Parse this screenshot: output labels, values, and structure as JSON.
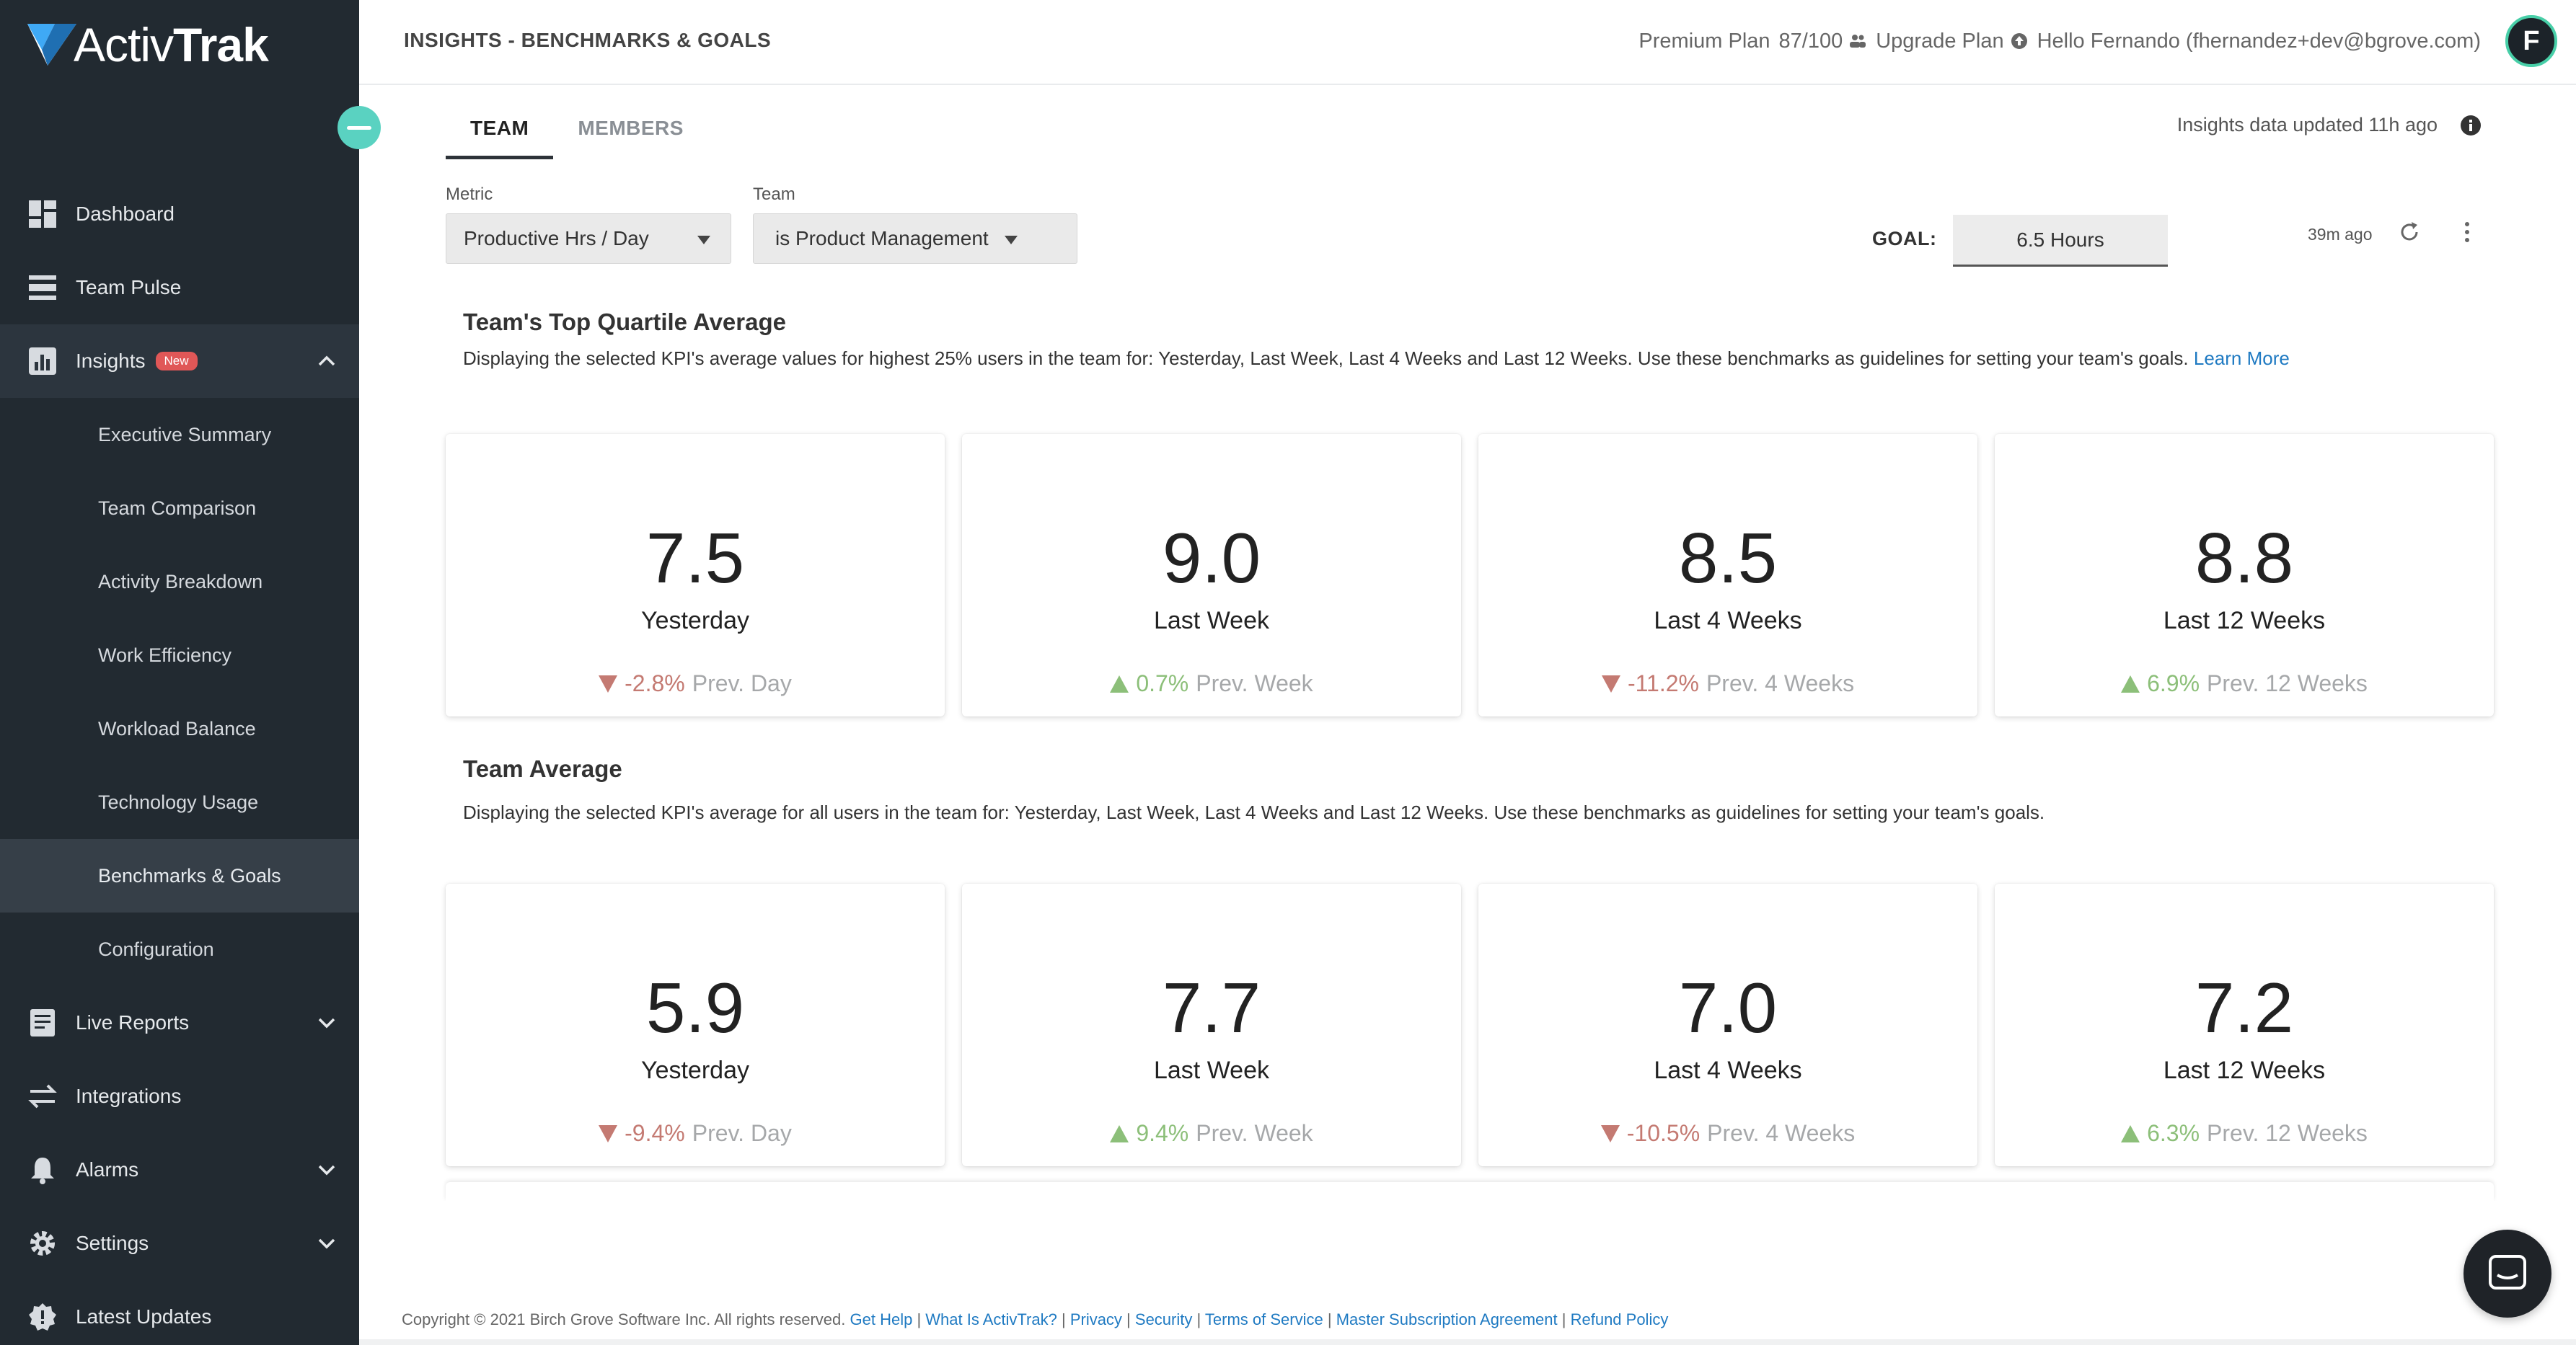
{
  "app": {
    "logo_text_light": "Activ",
    "logo_text_bold": "Trak"
  },
  "sidebar": {
    "items": [
      {
        "label": "Dashboard",
        "icon": "dashboard-icon"
      },
      {
        "label": "Team Pulse",
        "icon": "team-pulse-icon"
      },
      {
        "label": "Insights",
        "icon": "insights-icon",
        "badge": "New",
        "expanded": true
      },
      {
        "label": "Live Reports",
        "icon": "live-reports-icon"
      },
      {
        "label": "Integrations",
        "icon": "integrations-icon"
      },
      {
        "label": "Alarms",
        "icon": "bell-icon"
      },
      {
        "label": "Settings",
        "icon": "gear-icon"
      },
      {
        "label": "Latest Updates",
        "icon": "badge-icon"
      }
    ],
    "insights_sub": [
      "Executive Summary",
      "Team Comparison",
      "Activity Breakdown",
      "Work Efficiency",
      "Workload Balance",
      "Technology Usage",
      "Benchmarks & Goals",
      "Configuration"
    ],
    "active_sub": "Benchmarks & Goals"
  },
  "header": {
    "title": "INSIGHTS - BENCHMARKS & GOALS",
    "plan": "Premium Plan",
    "seats": "87/100",
    "upgrade": "Upgrade Plan",
    "greeting": "Hello Fernando (fhernandez+dev@bgrove.com)",
    "avatar_initial": "F"
  },
  "tabs": [
    {
      "label": "TEAM",
      "active": true
    },
    {
      "label": "MEMBERS",
      "active": false
    }
  ],
  "updated_text": "Insights data updated 11h ago",
  "filters": {
    "metric_label": "Metric",
    "metric_value": "Productive Hrs / Day",
    "team_label": "Team",
    "team_value": "is Product Management",
    "goal_label": "GOAL:",
    "goal_value": "6.5 Hours",
    "refreshed": "39m ago"
  },
  "sections": {
    "top_quartile": {
      "title": "Team's Top Quartile Average",
      "desc": "Displaying the selected KPI's average values for highest 25% users in the team for: Yesterday, Last Week, Last 4 Weeks and Last 12 Weeks. Use these benchmarks as guidelines for setting your team's goals.",
      "link": "Learn More",
      "cards": [
        {
          "value": "7.5",
          "period": "Yesterday",
          "direction": "down",
          "pct": "-2.8%",
          "compare": "Prev. Day"
        },
        {
          "value": "9.0",
          "period": "Last Week",
          "direction": "up",
          "pct": "0.7%",
          "compare": "Prev. Week"
        },
        {
          "value": "8.5",
          "period": "Last 4 Weeks",
          "direction": "down",
          "pct": "-11.2%",
          "compare": "Prev. 4 Weeks"
        },
        {
          "value": "8.8",
          "period": "Last 12 Weeks",
          "direction": "up",
          "pct": "6.9%",
          "compare": "Prev. 12 Weeks"
        }
      ]
    },
    "team_average": {
      "title": "Team Average",
      "desc": "Displaying the selected KPI's average for all users in the team for: Yesterday, Last Week, Last 4 Weeks and Last 12 Weeks. Use these benchmarks as guidelines for setting your team's goals.",
      "cards": [
        {
          "value": "5.9",
          "period": "Yesterday",
          "direction": "down",
          "pct": "-9.4%",
          "compare": "Prev. Day"
        },
        {
          "value": "7.7",
          "period": "Last Week",
          "direction": "up",
          "pct": "9.4%",
          "compare": "Prev. Week"
        },
        {
          "value": "7.0",
          "period": "Last 4 Weeks",
          "direction": "down",
          "pct": "-10.5%",
          "compare": "Prev. 4 Weeks"
        },
        {
          "value": "7.2",
          "period": "Last 12 Weeks",
          "direction": "up",
          "pct": "6.3%",
          "compare": "Prev. 12 Weeks"
        }
      ]
    }
  },
  "footer": {
    "copyright": "Copyright © 2021 Birch Grove Software Inc. All rights reserved.",
    "links": [
      "Get Help",
      "What Is ActivTrak?",
      "Privacy",
      "Security",
      "Terms of Service",
      "Master Subscription Agreement",
      "Refund Policy"
    ]
  },
  "colors": {
    "sidebar_bg": "#222a31",
    "accent_teal": "#5ad2c1",
    "down": "#c47a72",
    "up": "#8cbf79",
    "link": "#1f7ac2"
  }
}
